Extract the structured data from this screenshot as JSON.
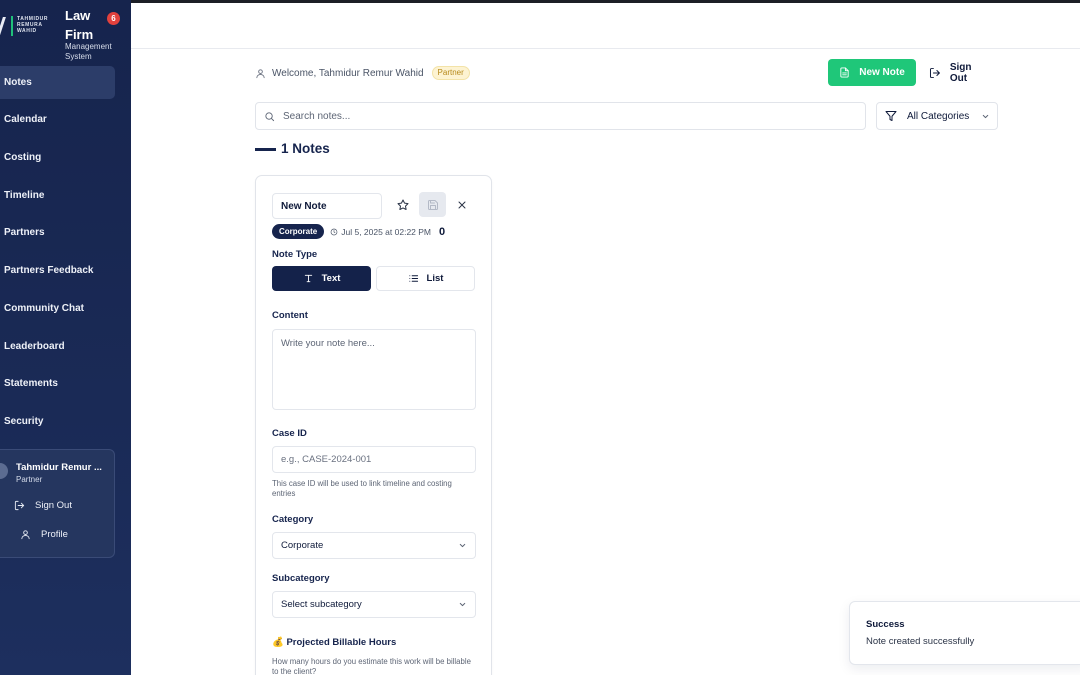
{
  "brand": {
    "tagline_lines": [
      "TAHMIDUR",
      "REMURA",
      "WAHID"
    ],
    "title": "Law Firm",
    "subtitle": "Management System",
    "notification_count": "6"
  },
  "sidebar": {
    "items": [
      {
        "label": "Notes",
        "active": true
      },
      {
        "label": "Calendar"
      },
      {
        "label": "Costing"
      },
      {
        "label": "Timeline"
      },
      {
        "label": "Partners"
      },
      {
        "label": "Partners Feedback"
      },
      {
        "label": "Community Chat"
      },
      {
        "label": "Leaderboard"
      },
      {
        "label": "Statements"
      },
      {
        "label": "Security"
      }
    ],
    "user": {
      "name": "Tahmidur Remur ...",
      "role": "Partner",
      "sign_out_label": "Sign Out",
      "profile_label": "Profile"
    }
  },
  "header": {
    "welcome_text": "Welcome, Tahmidur Remur Wahid",
    "role_badge": "Partner",
    "new_note_label": "New Note",
    "sign_out_label": "Sign Out"
  },
  "toolbar": {
    "search_placeholder": "Search notes...",
    "category_filter": "All Categories"
  },
  "notes_count_title": "1 Notes",
  "note_card": {
    "title_value": "New Note",
    "category_tag": "Corporate",
    "date": "Jul 5, 2025 at 02:22 PM",
    "counter": "0",
    "note_type_label": "Note Type",
    "type_options": [
      "Text",
      "List"
    ],
    "selected_type": "Text",
    "content_label": "Content",
    "content_placeholder": "Write your note here...",
    "case_id_label": "Case ID",
    "case_id_placeholder": "e.g., CASE-2024-001",
    "case_id_help": "This case ID will be used to link timeline and costing entries",
    "category_label": "Category",
    "category_value": "Corporate",
    "subcategory_label": "Subcategory",
    "subcategory_value": "Select subcategory",
    "billable_label": "💰 Projected Billable Hours",
    "billable_help": "How many hours do you estimate this work will be billable to the client?"
  },
  "toast": {
    "title": "Success",
    "message": "Note created successfully"
  },
  "colors": {
    "sidebar_bg": "#16244d",
    "accent_green": "#1fc779",
    "navy": "#14224a",
    "notification_red": "#e2413d"
  }
}
